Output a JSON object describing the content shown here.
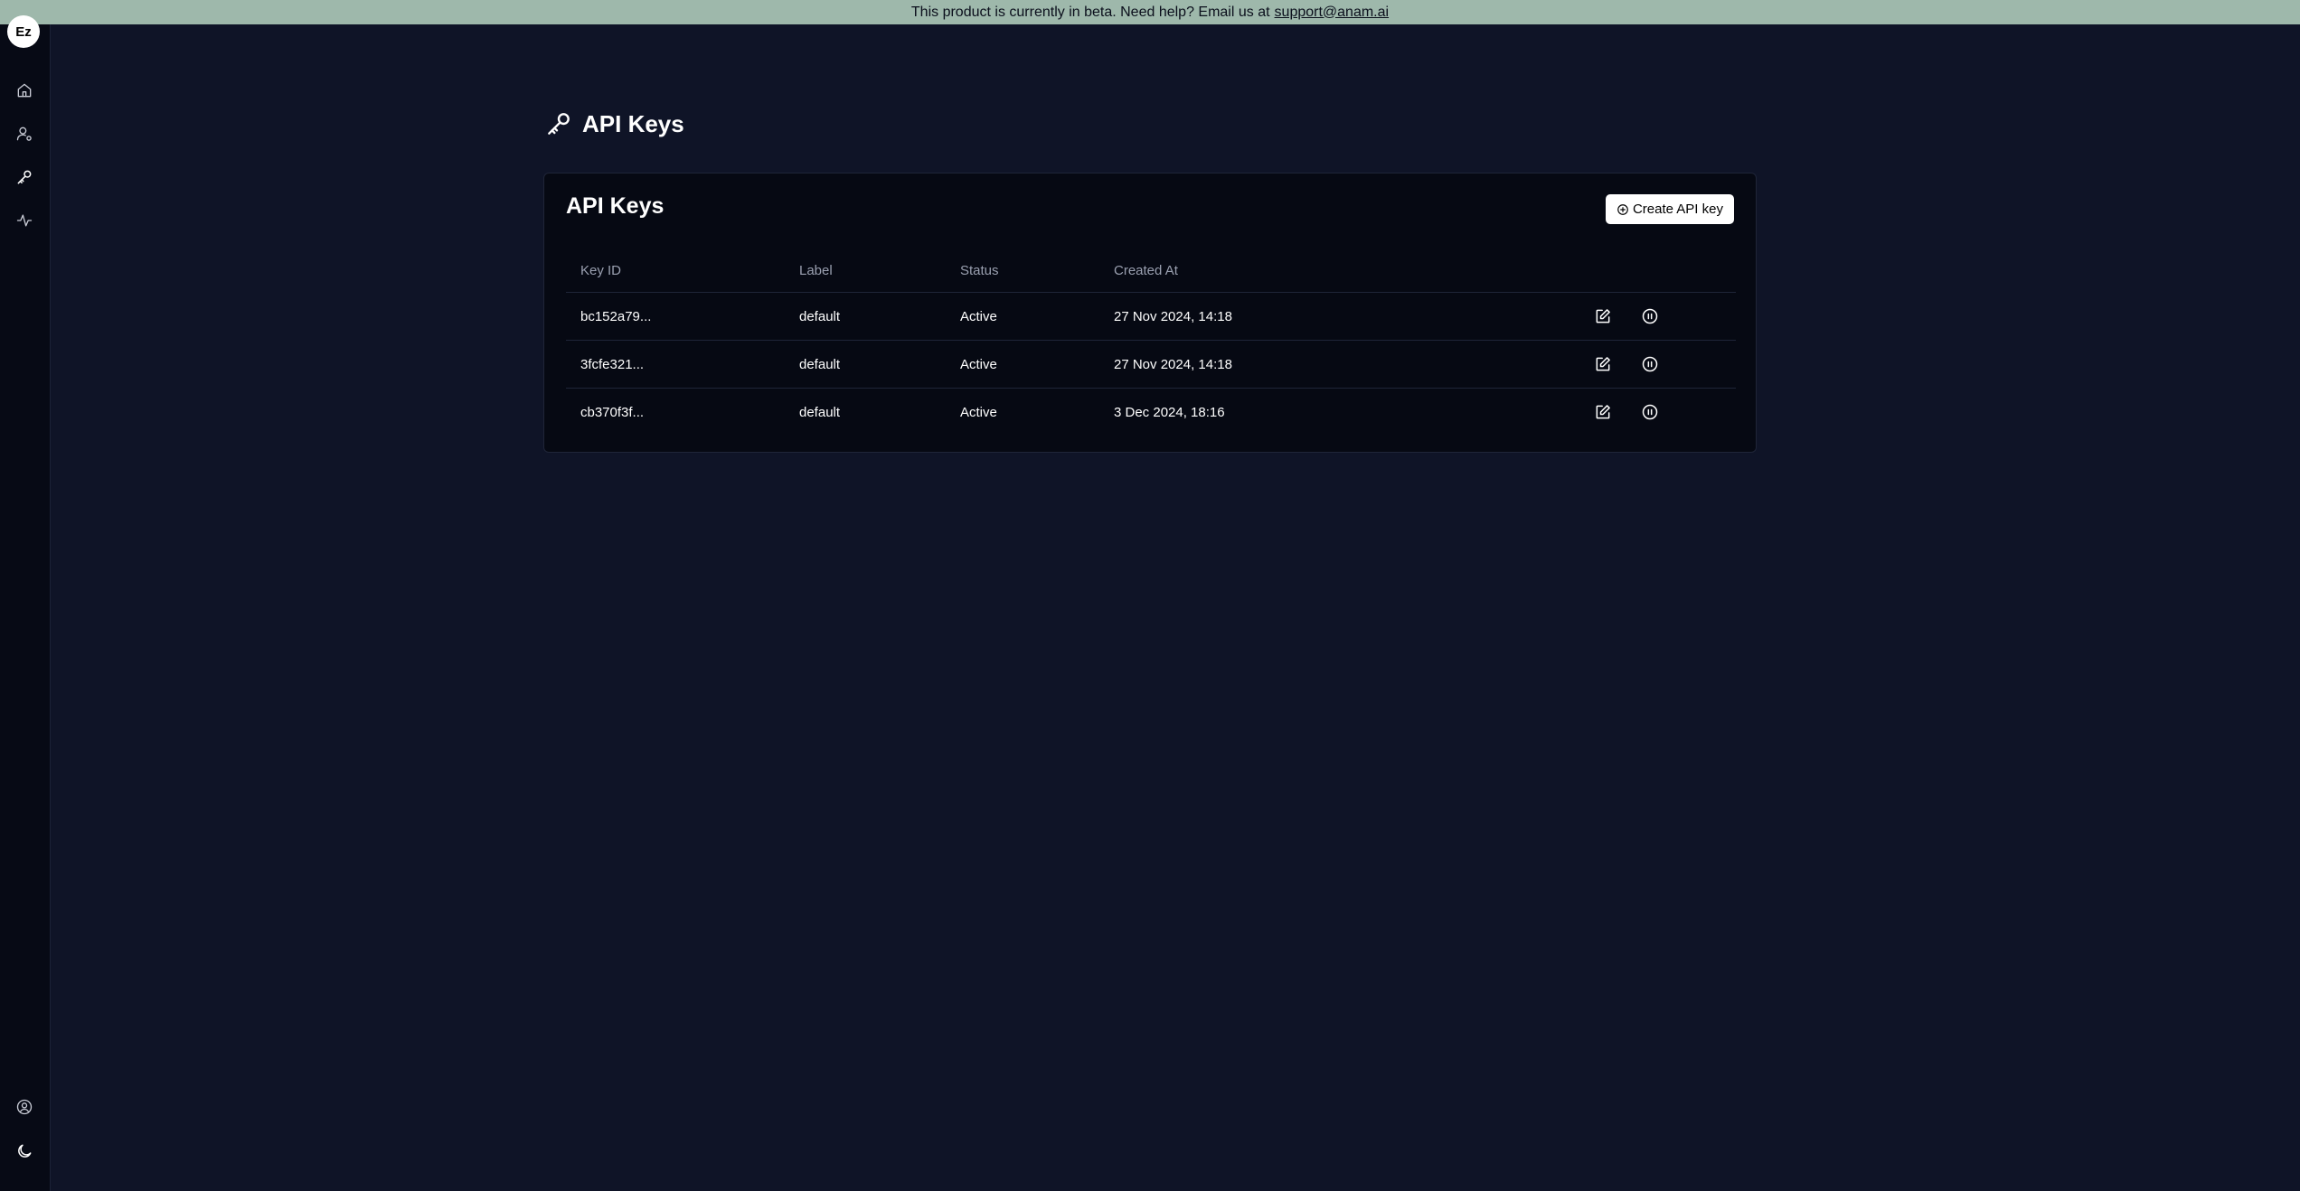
{
  "banner": {
    "text": "This product is currently in beta. Need help? Email us at",
    "link": "support@anam.ai"
  },
  "sidebar": {
    "avatar_initials": "Ez",
    "items": [
      {
        "name": "home",
        "icon": "home-icon"
      },
      {
        "name": "personas",
        "icon": "user-settings-icon"
      },
      {
        "name": "api-keys",
        "icon": "key-icon",
        "active": true
      },
      {
        "name": "activity",
        "icon": "activity-icon"
      }
    ],
    "bottom": [
      {
        "name": "account",
        "icon": "user-circle-icon"
      },
      {
        "name": "theme",
        "icon": "moon-icon"
      }
    ]
  },
  "page": {
    "title": "API Keys"
  },
  "card": {
    "title": "API Keys",
    "create_button": "Create API key"
  },
  "table": {
    "headers": {
      "key_id": "Key ID",
      "label": "Label",
      "status": "Status",
      "created_at": "Created At"
    },
    "rows": [
      {
        "key_id": "bc152a79...",
        "label": "default",
        "status": "Active",
        "created_at": "27 Nov 2024, 14:18"
      },
      {
        "key_id": "3fcfe321...",
        "label": "default",
        "status": "Active",
        "created_at": "27 Nov 2024, 14:18"
      },
      {
        "key_id": "cb370f3f...",
        "label": "default",
        "status": "Active",
        "created_at": "3 Dec 2024, 18:16"
      }
    ]
  },
  "colors": {
    "background": "#0f1427",
    "sidebar": "#070a15",
    "banner": "#9eb8ab",
    "card": "#060913"
  }
}
